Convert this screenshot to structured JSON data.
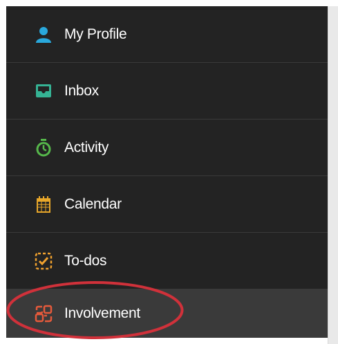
{
  "menu": {
    "items": [
      {
        "label": "My Profile",
        "icon": "user-icon",
        "color": "#29a8dc",
        "active": false
      },
      {
        "label": "Inbox",
        "icon": "inbox-icon",
        "color": "#35b394",
        "active": false
      },
      {
        "label": "Activity",
        "icon": "stopwatch-icon",
        "color": "#56b84b",
        "active": false
      },
      {
        "label": "Calendar",
        "icon": "calendar-icon",
        "color": "#e8a72a",
        "active": false
      },
      {
        "label": "To-dos",
        "icon": "todo-icon",
        "color": "#f0a12e",
        "active": false
      },
      {
        "label": "Involvement",
        "icon": "involvement-icon",
        "color": "#e65a3b",
        "active": true
      }
    ]
  },
  "annotation": {
    "color": "#d0313a"
  }
}
